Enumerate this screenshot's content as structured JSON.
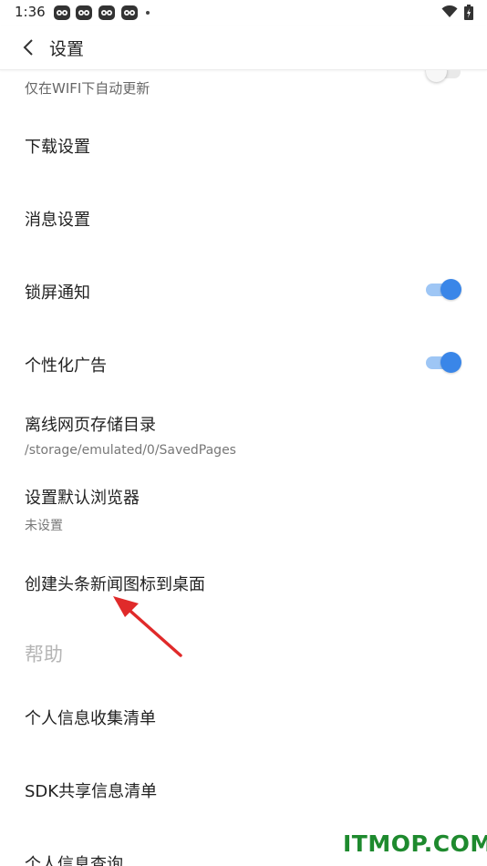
{
  "status_bar": {
    "time": "1:36",
    "notification_icons": [
      "app-notification-icon",
      "app-notification-icon",
      "app-notification-icon",
      "app-notification-icon"
    ],
    "icons": [
      "wifi-icon",
      "battery-icon"
    ]
  },
  "header": {
    "title": "设置",
    "back_icon": "chevron-left-icon"
  },
  "settings": {
    "wifi_auto_update": {
      "label": "仅在WIFI下自动更新",
      "enabled": false
    },
    "download": {
      "label": "下载设置"
    },
    "message": {
      "label": "消息设置"
    },
    "lockscreen": {
      "label": "锁屏通知",
      "enabled": true
    },
    "personalized_ads": {
      "label": "个性化广告",
      "enabled": true
    },
    "offline_dir": {
      "label": "离线网页存储目录",
      "value": "/storage/emulated/0/SavedPages"
    },
    "default_browser": {
      "label": "设置默认浏览器",
      "value": "未设置"
    },
    "desktop_icon": {
      "label": "创建头条新闻图标到桌面"
    }
  },
  "help": {
    "title": "帮助",
    "items": [
      {
        "label": "个人信息收集清单"
      },
      {
        "label": "SDK共享信息清单"
      },
      {
        "label": "个人信息查询"
      }
    ]
  },
  "annotation": {
    "color": "#e02a2a"
  },
  "watermark": {
    "text": "ITMOP.COM",
    "color": "#1e8a2e"
  },
  "colors": {
    "accent": "#3a86e8",
    "accent_light": "#9ec6f5"
  }
}
